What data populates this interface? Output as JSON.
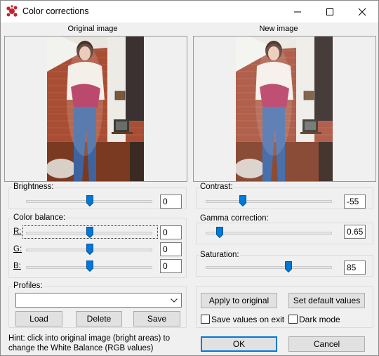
{
  "window": {
    "title": "Color corrections"
  },
  "images": {
    "original_label": "Original image",
    "new_label": "New image"
  },
  "brightness": {
    "label": "Brightness:",
    "value": "0",
    "level": 0.5
  },
  "color_balance": {
    "label": "Color balance:",
    "r": {
      "label": "R:",
      "value": "0",
      "level": 0.5
    },
    "g": {
      "label": "G:",
      "value": "0",
      "level": 0.5
    },
    "b": {
      "label": "B:",
      "value": "0",
      "level": 0.5
    }
  },
  "profiles": {
    "label": "Profiles:",
    "selected": "",
    "load_label": "Load",
    "delete_label": "Delete",
    "save_label": "Save"
  },
  "hint": {
    "line1": "Hint: click into original image (bright areas) to",
    "line2": "change the White Balance (RGB values)"
  },
  "contrast": {
    "label": "Contrast:",
    "value": "-55",
    "level": 0.29
  },
  "gamma": {
    "label": "Gamma correction:",
    "value": "0.65",
    "level": 0.11
  },
  "saturation": {
    "label": "Saturation:",
    "value": "85",
    "level": 0.67
  },
  "actions": {
    "apply_label": "Apply to original",
    "defaults_label": "Set default values",
    "save_on_exit_label": "Save values on exit",
    "save_on_exit_checked": false,
    "dark_mode_label": "Dark mode",
    "dark_mode_checked": false,
    "ok_label": "OK",
    "cancel_label": "Cancel"
  },
  "colors": {
    "accent": "#0078d7",
    "app_icon": "#c0262e"
  }
}
